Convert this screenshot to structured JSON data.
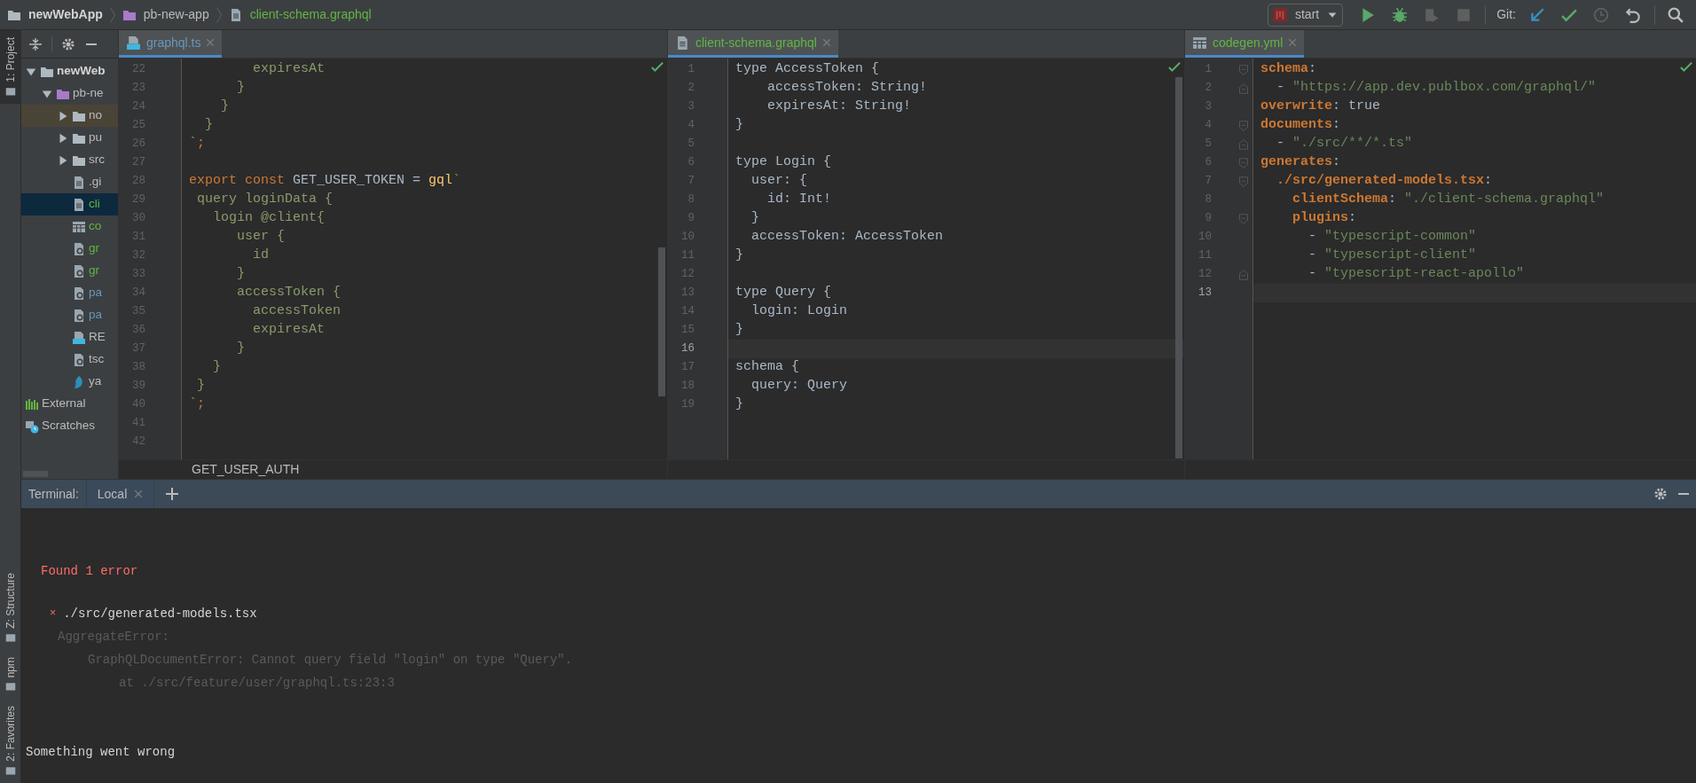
{
  "breadcrumbs": [
    {
      "label": "newWebApp",
      "kind": "folder"
    },
    {
      "label": "pb-new-app",
      "kind": "module"
    },
    {
      "label": "client-schema.graphql",
      "kind": "file"
    }
  ],
  "toolbar": {
    "run_config": "start",
    "git_label": "Git:"
  },
  "tool_strip": {
    "top": [
      {
        "label": "1: Project",
        "selected": true
      }
    ],
    "bottom": [
      {
        "label": "Z: Structure",
        "selected": false
      },
      {
        "label": "npm",
        "selected": false
      },
      {
        "label": "2: Favorites",
        "selected": false
      }
    ]
  },
  "project_tree": [
    {
      "label": "newWeb",
      "kind": "folder",
      "expanded": true,
      "selected": false,
      "excluded": false,
      "color": "#d4d4d4",
      "children": [
        {
          "label": "pb-ne",
          "kind": "module",
          "expanded": true,
          "selected": false,
          "excluded": false,
          "color": "#bbbbbb",
          "children": [
            {
              "label": "no",
              "kind": "folder",
              "expanded": false,
              "selected": false,
              "excluded": true,
              "color": "#bbbbbb"
            },
            {
              "label": "pu",
              "kind": "folder",
              "expanded": false,
              "selected": false,
              "excluded": false,
              "color": "#bbbbbb"
            },
            {
              "label": "src",
              "kind": "folder",
              "expanded": false,
              "selected": false,
              "excluded": false,
              "color": "#bbbbbb"
            },
            {
              "label": ".gi",
              "kind": "file",
              "selected": false,
              "excluded": false,
              "color": "#bbbbbb"
            },
            {
              "label": "cli",
              "kind": "file",
              "selected": true,
              "excluded": false,
              "color": "#62b543"
            },
            {
              "label": "co",
              "kind": "table",
              "selected": false,
              "excluded": false,
              "color": "#62b543"
            },
            {
              "label": "gr",
              "kind": "config",
              "selected": false,
              "excluded": false,
              "color": "#62b543"
            },
            {
              "label": "gr",
              "kind": "config",
              "selected": false,
              "excluded": false,
              "color": "#62b543"
            },
            {
              "label": "pa",
              "kind": "config",
              "selected": false,
              "excluded": false,
              "color": "#6897bb"
            },
            {
              "label": "pa",
              "kind": "config",
              "selected": false,
              "excluded": false,
              "color": "#6897bb"
            },
            {
              "label": "RE",
              "kind": "markdown",
              "selected": false,
              "excluded": false,
              "color": "#bbbbbb"
            },
            {
              "label": "tsc",
              "kind": "config",
              "selected": false,
              "excluded": false,
              "color": "#bbbbbb"
            },
            {
              "label": "ya",
              "kind": "yarn",
              "selected": false,
              "excluded": false,
              "color": "#bbbbbb"
            }
          ]
        }
      ]
    },
    {
      "label": "External",
      "kind": "libraries",
      "selected": false,
      "excluded": false,
      "color": "#bbbbbb"
    },
    {
      "label": "Scratches",
      "kind": "scratches",
      "selected": false,
      "excluded": false,
      "color": "#bbbbbb"
    }
  ],
  "editors": [
    {
      "tab": {
        "label": "graphql.ts",
        "kind": "ts",
        "color": "#6897bb",
        "selected": true
      },
      "footer": "GET_USER_AUTH",
      "lines": [
        {
          "number": "22",
          "current": false,
          "tokens": [
            {
              "text": "        expiresAt",
              "kind": "tmpl"
            }
          ]
        },
        {
          "number": "23",
          "current": false,
          "tokens": [
            {
              "text": "      }",
              "kind": "tmpl"
            }
          ]
        },
        {
          "number": "24",
          "current": false,
          "tokens": [
            {
              "text": "    }",
              "kind": "tmpl"
            }
          ]
        },
        {
          "number": "25",
          "current": false,
          "tokens": [
            {
              "text": "  }",
              "kind": "tmpl"
            }
          ]
        },
        {
          "number": "26",
          "current": false,
          "tokens": [
            {
              "text": "`",
              "kind": "tmpl"
            },
            {
              "text": ";",
              "kind": "keyword"
            }
          ]
        },
        {
          "number": "27",
          "current": false
        },
        {
          "number": "28",
          "current": false,
          "tokens": [
            {
              "text": "export const ",
              "kind": "keyword"
            },
            {
              "text": "GET_USER_TOKEN = ",
              "kind": "plain"
            },
            {
              "text": "gql",
              "kind": "func"
            },
            {
              "text": "`",
              "kind": "tmpl"
            }
          ]
        },
        {
          "number": "29",
          "current": false,
          "tokens": [
            {
              "text": " query loginData {",
              "kind": "tmpl"
            }
          ]
        },
        {
          "number": "30",
          "current": false,
          "tokens": [
            {
              "text": "   login @client{",
              "kind": "tmpl"
            }
          ]
        },
        {
          "number": "31",
          "current": false,
          "tokens": [
            {
              "text": "      user {",
              "kind": "tmpl"
            }
          ]
        },
        {
          "number": "32",
          "current": false,
          "tokens": [
            {
              "text": "        id",
              "kind": "tmpl"
            }
          ]
        },
        {
          "number": "33",
          "current": false,
          "tokens": [
            {
              "text": "      }",
              "kind": "tmpl"
            }
          ]
        },
        {
          "number": "34",
          "current": false,
          "tokens": [
            {
              "text": "      accessToken {",
              "kind": "tmpl"
            }
          ]
        },
        {
          "number": "35",
          "current": false,
          "tokens": [
            {
              "text": "        accessToken",
              "kind": "tmpl"
            }
          ]
        },
        {
          "number": "36",
          "current": false,
          "tokens": [
            {
              "text": "        expiresAt",
              "kind": "tmpl"
            }
          ]
        },
        {
          "number": "37",
          "current": false,
          "tokens": [
            {
              "text": "      }",
              "kind": "tmpl"
            }
          ]
        },
        {
          "number": "38",
          "current": false,
          "tokens": [
            {
              "text": "   }",
              "kind": "tmpl"
            }
          ]
        },
        {
          "number": "39",
          "current": false,
          "tokens": [
            {
              "text": " }",
              "kind": "tmpl"
            }
          ]
        },
        {
          "number": "40",
          "current": false,
          "tokens": [
            {
              "text": "`",
              "kind": "tmpl"
            },
            {
              "text": ";",
              "kind": "keyword"
            }
          ]
        },
        {
          "number": "41",
          "current": false
        },
        {
          "number": "42",
          "current": false
        }
      ]
    },
    {
      "tab": {
        "label": "client-schema.graphql",
        "kind": "file",
        "color": "#62b543",
        "selected": true
      },
      "lines": [
        {
          "number": "1",
          "current": false,
          "tokens": [
            {
              "text": "type AccessToken {",
              "kind": "plain"
            }
          ]
        },
        {
          "number": "2",
          "current": false,
          "tokens": [
            {
              "text": "    accessToken: String!",
              "kind": "plain"
            }
          ]
        },
        {
          "number": "3",
          "current": false,
          "tokens": [
            {
              "text": "    expiresAt: String!",
              "kind": "plain"
            }
          ]
        },
        {
          "number": "4",
          "current": false,
          "tokens": [
            {
              "text": "}",
              "kind": "plain"
            }
          ]
        },
        {
          "number": "5",
          "current": false
        },
        {
          "number": "6",
          "current": false,
          "tokens": [
            {
              "text": "type Login {",
              "kind": "plain"
            }
          ]
        },
        {
          "number": "7",
          "current": false,
          "tokens": [
            {
              "text": "  user: {",
              "kind": "plain"
            }
          ]
        },
        {
          "number": "8",
          "current": false,
          "tokens": [
            {
              "text": "    id: Int!",
              "kind": "plain"
            }
          ]
        },
        {
          "number": "9",
          "current": false,
          "tokens": [
            {
              "text": "  }",
              "kind": "plain"
            }
          ]
        },
        {
          "number": "10",
          "current": false,
          "tokens": [
            {
              "text": "  accessToken: AccessToken",
              "kind": "plain"
            }
          ]
        },
        {
          "number": "11",
          "current": false,
          "tokens": [
            {
              "text": "}",
              "kind": "plain"
            }
          ]
        },
        {
          "number": "12",
          "current": false
        },
        {
          "number": "13",
          "current": false,
          "tokens": [
            {
              "text": "type Query {",
              "kind": "plain"
            }
          ]
        },
        {
          "number": "14",
          "current": false,
          "tokens": [
            {
              "text": "  login: Login",
              "kind": "plain"
            }
          ]
        },
        {
          "number": "15",
          "current": false,
          "tokens": [
            {
              "text": "}",
              "kind": "plain"
            }
          ]
        },
        {
          "number": "16",
          "current": true
        },
        {
          "number": "17",
          "current": false,
          "tokens": [
            {
              "text": "schema {",
              "kind": "plain"
            }
          ]
        },
        {
          "number": "18",
          "current": false,
          "tokens": [
            {
              "text": "  query: Query",
              "kind": "plain"
            }
          ]
        },
        {
          "number": "19",
          "current": false,
          "tokens": [
            {
              "text": "}",
              "kind": "plain"
            }
          ]
        }
      ]
    },
    {
      "tab": {
        "label": "codegen.yml",
        "kind": "table",
        "color": "#62b543",
        "selected": true
      },
      "lines": [
        {
          "number": "1",
          "current": false,
          "kind": "fold_start",
          "tokens": [
            {
              "text": "schema",
              "kind": "key"
            },
            {
              "text": ":",
              "kind": "plain"
            }
          ]
        },
        {
          "number": "2",
          "current": false,
          "kind": "fold_end",
          "tokens": [
            {
              "text": "  - ",
              "kind": "plain"
            },
            {
              "text": "\"https://app.dev.publbox.com/graphql/\"",
              "kind": "string"
            }
          ]
        },
        {
          "number": "3",
          "current": false,
          "tokens": [
            {
              "text": "overwrite",
              "kind": "key"
            },
            {
              "text": ": true",
              "kind": "plain"
            }
          ]
        },
        {
          "number": "4",
          "current": false,
          "kind": "fold_start",
          "tokens": [
            {
              "text": "documents",
              "kind": "key"
            },
            {
              "text": ":",
              "kind": "plain"
            }
          ]
        },
        {
          "number": "5",
          "current": false,
          "kind": "fold_end",
          "tokens": [
            {
              "text": "  - ",
              "kind": "plain"
            },
            {
              "text": "\"./src/**/*.ts\"",
              "kind": "string"
            }
          ]
        },
        {
          "number": "6",
          "current": false,
          "kind": "fold_start",
          "tokens": [
            {
              "text": "generates",
              "kind": "key"
            },
            {
              "text": ":",
              "kind": "plain"
            }
          ]
        },
        {
          "number": "7",
          "current": false,
          "kind": "fold_start",
          "tokens": [
            {
              "text": "  ./src/generated-models.tsx",
              "kind": "key"
            },
            {
              "text": ":",
              "kind": "plain"
            }
          ]
        },
        {
          "number": "8",
          "current": false,
          "tokens": [
            {
              "text": "    clientSchema",
              "kind": "key"
            },
            {
              "text": ": ",
              "kind": "plain"
            },
            {
              "text": "\"./client-schema.graphql\"",
              "kind": "string"
            }
          ]
        },
        {
          "number": "9",
          "current": false,
          "kind": "fold_start",
          "tokens": [
            {
              "text": "    plugins",
              "kind": "key"
            },
            {
              "text": ":",
              "kind": "plain"
            }
          ]
        },
        {
          "number": "10",
          "current": false,
          "tokens": [
            {
              "text": "      - ",
              "kind": "plain"
            },
            {
              "text": "\"typescript-common\"",
              "kind": "string"
            }
          ]
        },
        {
          "number": "11",
          "current": false,
          "tokens": [
            {
              "text": "      - ",
              "kind": "plain"
            },
            {
              "text": "\"typescript-client\"",
              "kind": "string"
            }
          ]
        },
        {
          "number": "12",
          "current": false,
          "kind": "fold_end",
          "tokens": [
            {
              "text": "      - ",
              "kind": "plain"
            },
            {
              "text": "\"typescript-react-apollo\"",
              "kind": "string"
            }
          ]
        },
        {
          "number": "13",
          "current": true
        }
      ]
    }
  ],
  "terminal": {
    "title": "Terminal:",
    "tabs": [
      {
        "label": "Local",
        "selected": true
      }
    ],
    "lines": [
      {
        "kind": "error",
        "text": "Found 1 error"
      },
      {
        "kind": "file",
        "marker": "×",
        "text": "./src/generated-models.tsx"
      },
      {
        "kind": "dim1",
        "text": "AggregateError:"
      },
      {
        "kind": "dim2",
        "text": "GraphQLDocumentError: Cannot query field \"login\" on type \"Query\"."
      },
      {
        "kind": "dim3",
        "text": "at ./src/feature/user/graphql.ts:23:3"
      },
      {
        "kind": "plain",
        "text": "Something went wrong"
      }
    ]
  }
}
